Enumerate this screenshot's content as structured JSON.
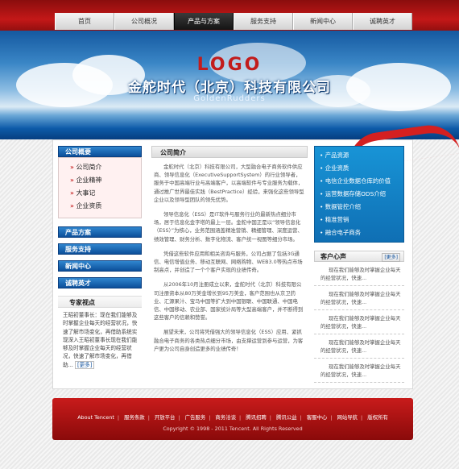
{
  "nav": [
    "首页",
    "公司概况",
    "产品与方案",
    "服务支持",
    "新闻中心",
    "诚聘英才"
  ],
  "nav_active_index": 2,
  "banner": {
    "logo": "LOGO",
    "company": "金舵时代（北京）科技有限公司",
    "company_en": "GoldenRudders"
  },
  "left": {
    "overview_title": "公司概要",
    "overview_items": [
      "公司简介",
      "企业精神",
      "大事记",
      "企业资质"
    ],
    "buttons": [
      "产品方案",
      "服务支持",
      "新闻中心",
      "诚聘英才"
    ],
    "expert_title": "专家视点",
    "expert_text": "王昭初董事长：现在我们能够及时掌握企业每天的经营状况，快速了解市场变化，再借助系统实现深入王昭初董事长现在我们能够及时掌握企业每天的经营状况，快速了解市场变化，再借助...",
    "more": "[更多]"
  },
  "middle": {
    "title": "公司简介",
    "paragraphs": [
      "金舵时代（北京）科技有限公司，大型融合电子商务软件供应商、领导信息化（ExecutiveSupportSystem）的行业领导者，服务于中国高端行业与高端客户，以高端软件与专业服务为载体，通过推广世界最佳实践（BestPractice）经验，来强化这些领导型企业以及领导型团队的领先优势。",
      "领导信息化（ESS）是IT软件与服务行业的最新热点细分市场，居于信息化金字塔的最上一层。金舵中国正是以“领导信息化（ESS）”为核心，业务范围涵盖精准营销、精细管理、深度运营、绩效管理、财务分析、数字化物流、客户统一视图等细分市场。",
      "凭借这些软件应用和相关咨询与服务，公司占据了包括3G通信、电信增值业务、移动互联网、网络购物、WEB3.0等热点市场制高点，并创造了一个个客户实现的业绩传奇。",
      "从2006年10月注册成立以来，金舵时代（北京）科技有限公司注册资本从80万美金增长到95万美金，客户范围也从京卫药业、汇源果汁、宝马中国等扩大到中国银联、中国联通、中国电信、中国移动、农业部、国家统计局等大型高端客户，并不断得到这些客户的信赖和赞誉。",
      "展望未来，公司将凭借强大的领导信息化（ESS）应用、紧抓融合电子商务的各类热点细分市场，由支撑运营到参与运营，为客户更为公司自身创造更多的业绩传奇！"
    ]
  },
  "right": {
    "blue_items": [
      "产品资源",
      "企业资质",
      "电信企业数据仓库的价值",
      "运营数据存储ODS介绍",
      "数据管控介绍",
      "精准营销",
      "融合电子商务"
    ],
    "voice_title": "客户心声",
    "voice_more": "[更多]",
    "voice_items": [
      "现在我们能够及时掌握企业每天的经营状况，快速...",
      "现在我们能够及时掌握企业每天的经营状况，快速...",
      "现在我们能够及时掌握企业每天的经营状况，快速...",
      "现在我们能够及时掌握企业每天的经营状况，快速...",
      "现在我们能够及时掌握企业每天的经营状况，快速..."
    ]
  },
  "footer": {
    "links": [
      "About Tencent",
      "服务条款",
      "开放平台",
      "广告服务",
      "商务洽谈",
      "腾讯招聘",
      "腾讯公益",
      "客服中心",
      "网站导航",
      "版权所有"
    ],
    "copyright": "Copyright © 1998 - 2011 Tencent. All Rights Reserved"
  },
  "colors": {
    "brand_red": "#c41818",
    "accent_blue": "#0f6fb4"
  }
}
